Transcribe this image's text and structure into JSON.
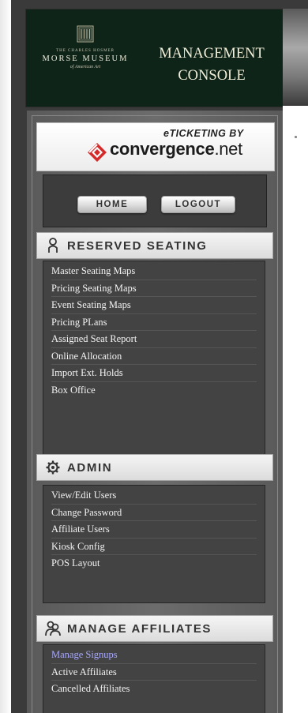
{
  "header": {
    "logo": {
      "small_text": "THE CHARLES HOSMER",
      "main_text": "MORSE MUSEUM",
      "sub_text": "of American Art"
    },
    "title_line1": "MANAGEMENT",
    "title_line2": "CONSOLE"
  },
  "brand": {
    "tagline": "eTICKETING BY",
    "name": "convergence",
    "tld": ".net"
  },
  "buttons": {
    "home": "HOME",
    "logout": "LOGOUT"
  },
  "sections": [
    {
      "title": "RESERVED SEATING",
      "icon": "person-icon",
      "items": [
        {
          "label": "Master Seating Maps"
        },
        {
          "label": "Pricing Seating Maps"
        },
        {
          "label": "Event Seating Maps"
        },
        {
          "label": "Pricing PLans"
        },
        {
          "label": "Assigned Seat Report"
        },
        {
          "label": "Online Allocation"
        },
        {
          "label": "Import Ext. Holds"
        },
        {
          "label": "Box Office"
        }
      ]
    },
    {
      "title": "ADMIN",
      "icon": "gear-icon",
      "items": [
        {
          "label": "View/Edit Users"
        },
        {
          "label": "Change Password"
        },
        {
          "label": "Affiliate Users"
        },
        {
          "label": "Kiosk Config"
        },
        {
          "label": "POS Layout"
        }
      ]
    },
    {
      "title": "MANAGE AFFILIATES",
      "icon": "group-icon",
      "items": [
        {
          "label": "Manage Signups",
          "active": true
        },
        {
          "label": "Active Affiliates"
        },
        {
          "label": "Cancelled Affiliates"
        }
      ]
    }
  ],
  "colors": {
    "header_bg": "#0e2419",
    "panel_bg": "#434343",
    "active_link": "#a8a8ff",
    "brand_red": "#d42a2a"
  }
}
